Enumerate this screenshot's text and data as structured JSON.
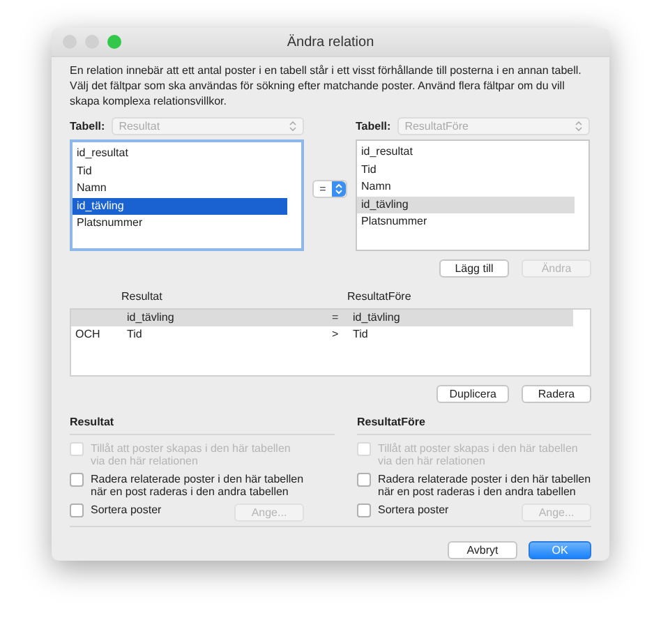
{
  "window": {
    "title": "Ändra relation",
    "controls": [
      {
        "color": "#d0d0d0"
      },
      {
        "color": "#d0d0d0"
      },
      {
        "color": "#34c84a"
      }
    ]
  },
  "description": "En relation innebär att ett antal poster i en tabell står i ett visst förhållande till posterna i en annan tabell. Välj det fältpar som ska användas för sökning efter matchande poster. Använd flera fältpar om du vill skapa komplexa relationsvillkor.",
  "left": {
    "label": "Tabell:",
    "table": "Resultat",
    "focused": true,
    "fields": [
      {
        "label": "id_resultat",
        "selected": false
      },
      {
        "label": "Tid",
        "selected": false
      },
      {
        "label": "Namn",
        "selected": false
      },
      {
        "label": "id_tävling",
        "selected": true
      },
      {
        "label": "Platsnummer",
        "selected": false
      }
    ]
  },
  "operator": "=",
  "right": {
    "label": "Tabell:",
    "table": "ResultatFöre",
    "focused": false,
    "fields": [
      {
        "label": "id_resultat",
        "selected": false
      },
      {
        "label": "Tid",
        "selected": false
      },
      {
        "label": "Namn",
        "selected": false
      },
      {
        "label": "id_tävling",
        "selected": true
      },
      {
        "label": "Platsnummer",
        "selected": false
      }
    ]
  },
  "pair_buttons": [
    {
      "label": "Lägg till",
      "disabled": false
    },
    {
      "label": "Ändra",
      "disabled": true
    }
  ],
  "criteria": {
    "columns": [
      "Resultat",
      "ResultatFöre"
    ],
    "rows": [
      {
        "left": "id_tävling",
        "operator": "=",
        "right": "id_tävling",
        "selected": true
      },
      {
        "conjunction": "OCH",
        "left": "Tid",
        "operator": ">",
        "right": "Tid",
        "selected": false
      }
    ]
  },
  "criteria_buttons": [
    {
      "label": "Duplicera",
      "disabled": false
    },
    {
      "label": "Radera",
      "disabled": false
    }
  ],
  "options": [
    {
      "title": "Resultat",
      "checkboxes": [
        {
          "label": "Tillåt att poster skapas i den här tabellen via den här relationen",
          "checked": false,
          "disabled": true
        },
        {
          "label": "Radera relaterade poster i den här tabellen när en post raderas i den andra tabellen",
          "checked": false,
          "disabled": false
        },
        {
          "label": "Sortera poster",
          "checked": false,
          "disabled": false
        }
      ],
      "sort_button": {
        "label": "Ange...",
        "disabled": true
      }
    },
    {
      "title": "ResultatFöre",
      "checkboxes": [
        {
          "label": "Tillåt att poster skapas i den här tabellen via den här relationen",
          "checked": false,
          "disabled": true
        },
        {
          "label": "Radera relaterade poster i den här tabellen när en post raderas i den andra tabellen",
          "checked": false,
          "disabled": false
        },
        {
          "label": "Sortera poster",
          "checked": false,
          "disabled": false
        }
      ],
      "sort_button": {
        "label": "Ange...",
        "disabled": true
      }
    }
  ],
  "footer_buttons": [
    {
      "label": "Avbryt",
      "kind": "normal"
    },
    {
      "label": "OK",
      "kind": "default"
    }
  ]
}
